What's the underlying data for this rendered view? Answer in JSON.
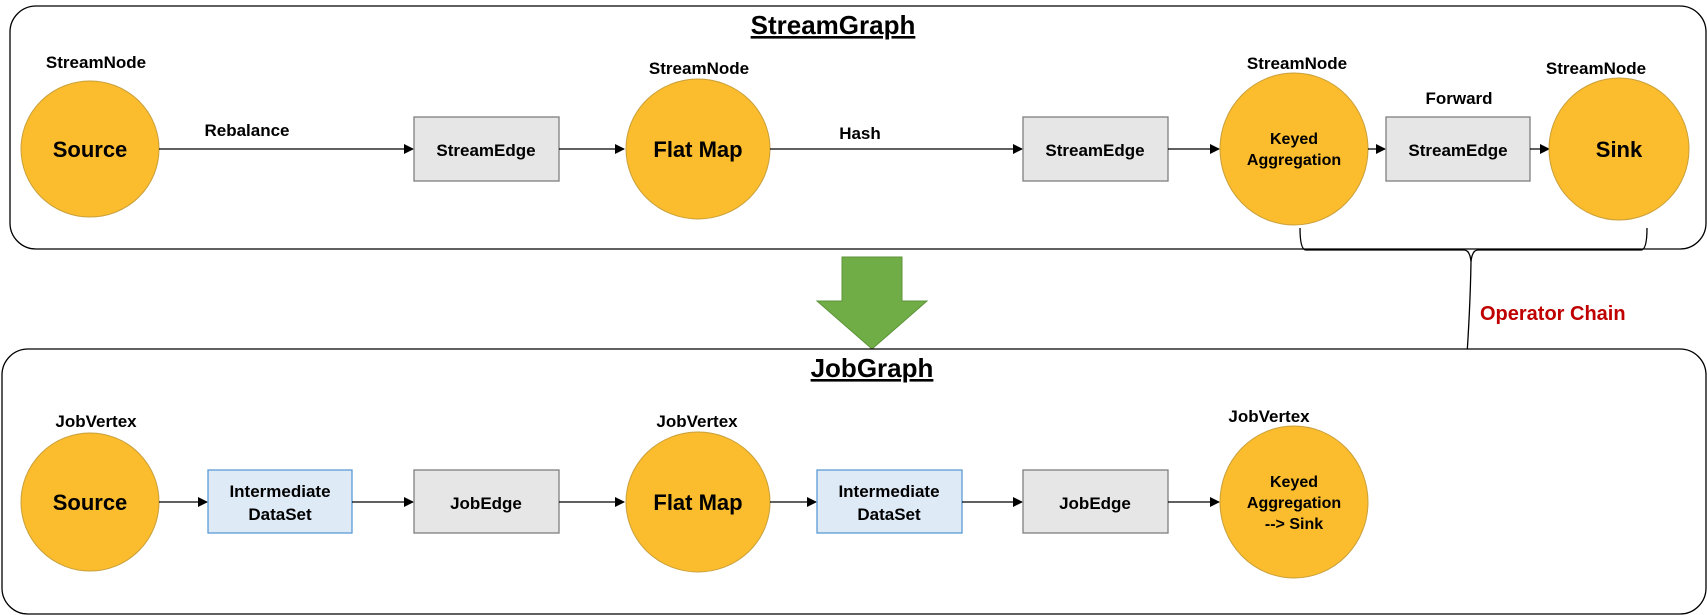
{
  "colors": {
    "node_fill": "#FBBC2D",
    "edge_box_fill": "#E6E6E6",
    "dataset_box_fill": "#DEEAF6",
    "dataset_box_border": "#5B9BD5",
    "transform_arrow": "#70AD47",
    "operator_chain_text": "#C00000"
  },
  "stream_graph": {
    "title": "StreamGraph",
    "nodes": [
      {
        "type_label": "StreamNode",
        "name": "Source"
      },
      {
        "type_label": "StreamNode",
        "name": "Flat Map"
      },
      {
        "type_label": "StreamNode",
        "name_lines": [
          "Keyed",
          "Aggregation"
        ]
      },
      {
        "type_label": "StreamNode",
        "name": "Sink"
      }
    ],
    "edges": [
      {
        "partitioner": "Rebalance",
        "label": "StreamEdge"
      },
      {
        "partitioner": "Hash",
        "label": "StreamEdge"
      },
      {
        "partitioner": "Forward",
        "label": "StreamEdge"
      }
    ]
  },
  "job_graph": {
    "title": "JobGraph",
    "vertices": [
      {
        "type_label": "JobVertex",
        "name": "Source"
      },
      {
        "type_label": "JobVertex",
        "name": "Flat Map"
      },
      {
        "type_label": "JobVertex",
        "name_lines": [
          "Keyed",
          "Aggregation",
          "--> Sink"
        ]
      }
    ],
    "datasets": [
      {
        "lines": [
          "Intermediate",
          "DataSet"
        ]
      },
      {
        "lines": [
          "Intermediate",
          "DataSet"
        ]
      }
    ],
    "edges": [
      {
        "label": "JobEdge"
      },
      {
        "label": "JobEdge"
      }
    ]
  },
  "annotation": {
    "operator_chain": "Operator Chain"
  }
}
